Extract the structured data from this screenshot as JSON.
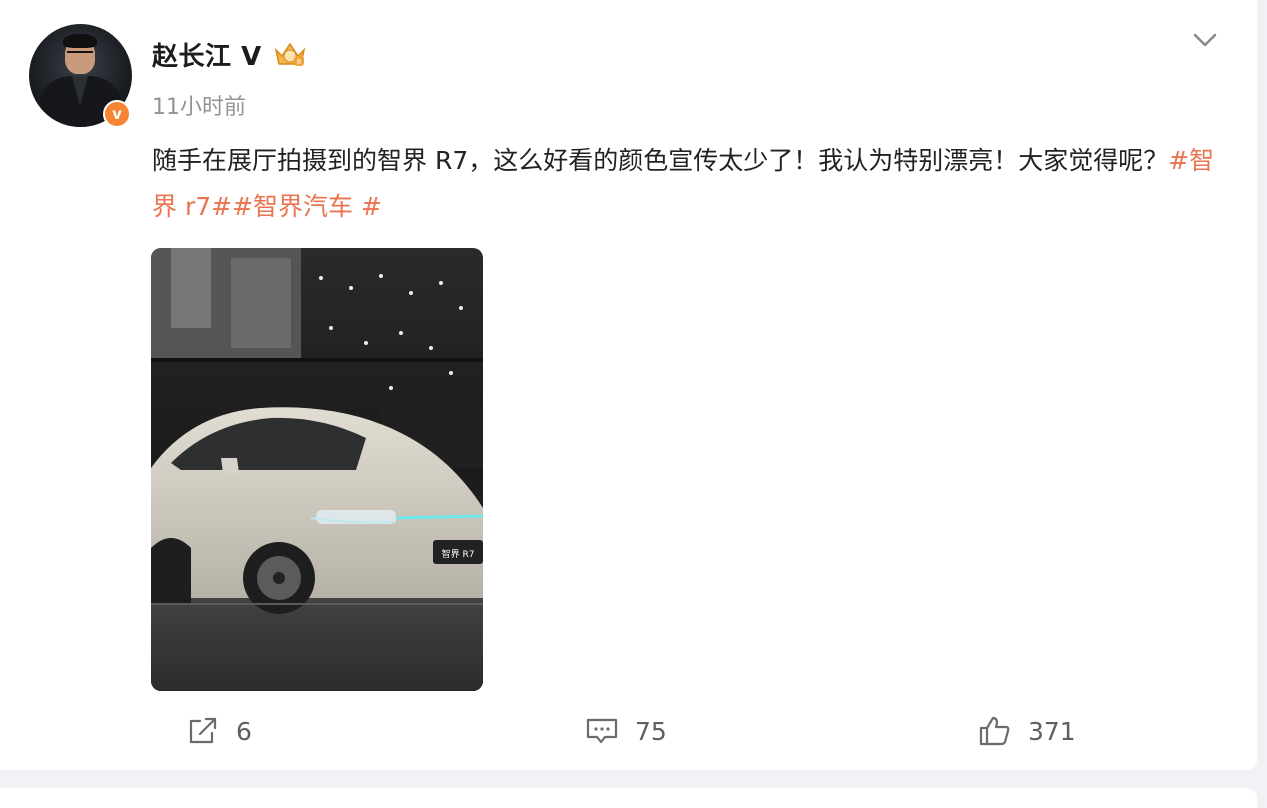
{
  "post": {
    "author": {
      "name": "赵长江",
      "verified_letter": "V",
      "verified_badge": "v",
      "badge_icon": "vip-crown-badge-icon",
      "avatar_icon": "user-avatar"
    },
    "time": "11小时前",
    "text": "随手在展厅拍摄到的智界 R7，这么好看的颜色宣传太少了！我认为特别漂亮！大家觉得呢？",
    "hashtags": [
      "#智界 r7#",
      "#智界汽车 #"
    ],
    "image": {
      "subject": "car-photo",
      "plate_text": "智界 R7"
    },
    "stats": {
      "reposts": "6",
      "comments": "75",
      "likes": "371"
    }
  },
  "icons": {
    "menu": "chevron-down-icon",
    "repost": "repost-icon",
    "comment": "comment-icon",
    "like": "thumbs-up-icon"
  },
  "colors": {
    "hashtag": "#eb7350",
    "verified": "#f78433",
    "background": "#f1f2f5"
  }
}
